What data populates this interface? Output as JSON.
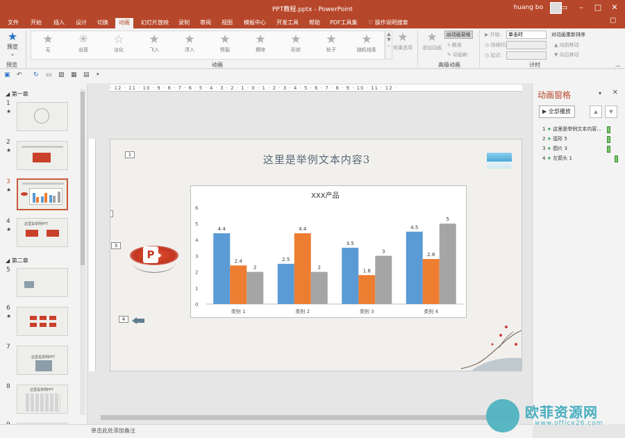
{
  "window": {
    "title": "PPT教程.pptx  -  PowerPoint",
    "user": "huang bo"
  },
  "tabs": [
    "文件",
    "开始",
    "插入",
    "设计",
    "切换",
    "动画",
    "幻灯片放映",
    "录制",
    "审阅",
    "视图",
    "模板中心",
    "开发工具",
    "帮助",
    "PDF工具集"
  ],
  "active_tab": "动画",
  "tell_me": "操作说明搜索",
  "ribbon": {
    "preview_label": "预览",
    "preview_group": "预览",
    "animations": [
      "无",
      "出现",
      "淡化",
      "飞入",
      "浮入",
      "劈裂",
      "擦除",
      "形状",
      "轮子",
      "随机线条"
    ],
    "effect_options": "效果选项",
    "animation_group": "动画",
    "add_animation": "添加动画",
    "animation_pane_btn": "动画窗格",
    "trigger": "触发",
    "anim_painter": "动画刷",
    "advanced_group": "高级动画",
    "start_label": "开始:",
    "start_value": "单击时",
    "duration_label": "持续时间:",
    "delay_label": "延迟:",
    "timing_group": "计时",
    "reorder_title": "对动画重新排序",
    "move_earlier": "向前移动",
    "move_later": "向后移动"
  },
  "thumbnails": {
    "section1": "第一章",
    "section2": "第二章",
    "slide_numbers": [
      "1",
      "2",
      "3",
      "4",
      "5",
      "6",
      "7",
      "8",
      "9"
    ],
    "star": "★",
    "slide4_text": "这里是举例PPT",
    "slide7_text": "这里是举例PPT",
    "slide8_text": "这里是举例PPT"
  },
  "ruler": "· 12 · 11 · 10 · 9 · 8 · 7 · 6 · 5 · 4 · 3 · 2 · 1 · 0 · 1 · 2 · 3 · 4 · 5 · 6 · 7 · 8 · 9 · 10 · 11 · 12 ·",
  "slide": {
    "title": "这里是举例文本内容3",
    "tags": [
      "1",
      "2",
      "3",
      "4"
    ]
  },
  "chart_data": {
    "type": "bar",
    "title": "XXX产品",
    "categories": [
      "类别 1",
      "类别 2",
      "类别 3",
      "类别 4"
    ],
    "series": [
      {
        "values": [
          4.4,
          2.5,
          3.5,
          4.5
        ],
        "color": "#5b9bd5"
      },
      {
        "values": [
          2.4,
          4.4,
          1.8,
          2.8
        ],
        "color": "#ed7d31"
      },
      {
        "values": [
          2,
          2,
          3,
          5
        ],
        "color": "#a5a5a5"
      }
    ],
    "ylim": [
      0,
      6
    ],
    "yticks": [
      "0",
      "1",
      "2",
      "3",
      "4",
      "5",
      "6"
    ],
    "grid": false,
    "legend": "none"
  },
  "pane": {
    "title": "动画窗格",
    "play_all": "全部播放",
    "items": [
      {
        "num": "1",
        "text": "这里是举例文本内容...",
        "bar_start": 0
      },
      {
        "num": "2",
        "text": "弧形 5",
        "bar_start": 0
      },
      {
        "num": "3",
        "text": "图片 3",
        "bar_start": 0
      },
      {
        "num": "4",
        "text": "左箭头 1",
        "bar_start": 1
      }
    ]
  },
  "notes_placeholder": "单击此处添加备注",
  "watermark": {
    "text": "欧菲资源网",
    "url": "www.office26.com"
  },
  "colors": {
    "accent": "#b7472a",
    "pane_bar": "#7ac46b"
  }
}
